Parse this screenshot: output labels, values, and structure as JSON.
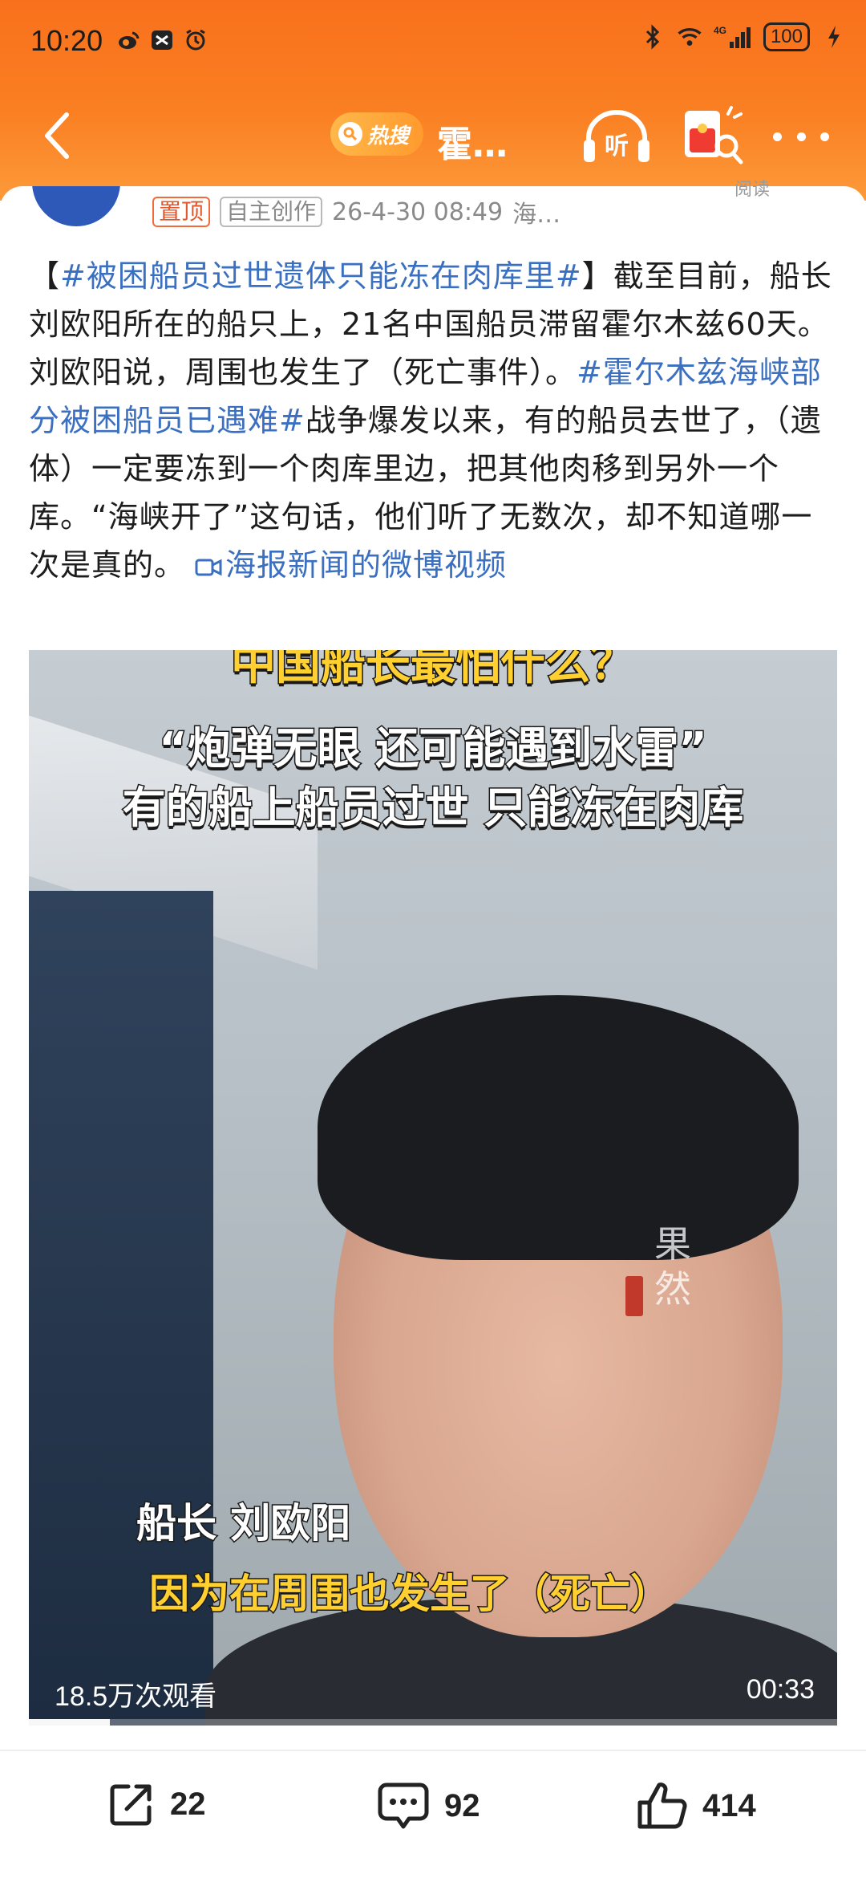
{
  "status_bar": {
    "time": "10:20",
    "battery": "100",
    "network": "4G"
  },
  "nav": {
    "hot_label": "热搜",
    "title": "霍…",
    "listen_label": "听"
  },
  "post": {
    "tag_top": "置顶",
    "tag_original": "自主创作",
    "timestamp": "26-4-30 08:49",
    "source": "海…",
    "read_label": "阅读",
    "segments": {
      "open_bracket": "【",
      "hashtag1": "#被困船员过世遗体只能冻在肉库里#",
      "p1": "】截至目前，船长刘欧阳所在的船只上，21名中国船员滞留霍尔木兹60天。刘欧阳说，周围也发生了（死亡事件）。",
      "hashtag2": "#霍尔木兹海峡部分被困船员已遇难#",
      "p2": "战争爆发以来，有的船员去世了，（遗体）一定要冻到一个肉库里边，把其他肉移到另外一个库。“海峡开了”这句话，他们听了无数次，却不知道哪一次是真的。",
      "video_link_icon": "video-link-icon",
      "video_link": "海报新闻的微博视频"
    }
  },
  "video": {
    "caption_title": "中国船长最怕什么？",
    "caption_quote": "“炮弹无眼 还可能遇到水雷”",
    "caption_line3": "有的船上船员过世 只能冻在肉库",
    "speaker": "船长 刘欧阳",
    "subtitle": "因为在周围也发生了（死亡）",
    "watermark": "果然",
    "views": "18.5万次观看",
    "duration": "00:33",
    "progress": 0.1
  },
  "actions": {
    "share_count": "22",
    "comment_count": "92",
    "like_count": "414"
  },
  "colors": {
    "brand_orange": "#fa7f22",
    "hashtag_blue": "#3b6fc0",
    "tag_red": "#e3572a"
  }
}
